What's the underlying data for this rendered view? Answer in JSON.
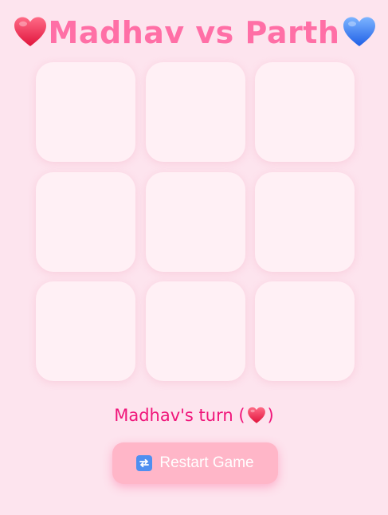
{
  "header": {
    "title": "Madhav vs Parth",
    "left_icon": "red-heart-icon",
    "right_icon": "blue-heart-icon"
  },
  "board": {
    "cells": [
      "",
      "",
      "",
      "",
      "",
      "",
      "",
      "",
      ""
    ]
  },
  "status": {
    "prefix": "Madhav's turn (",
    "suffix": ")",
    "icon": "red-heart-icon"
  },
  "restart": {
    "label": "Restart Game",
    "icon": "refresh-icon"
  },
  "colors": {
    "background": "#fde4ee",
    "title": "#ff6fa6",
    "status": "#f0157a",
    "button": "#ffb6c8",
    "cell": "#fff0f5",
    "player1": "#ff2d55",
    "player2": "#3b7cff"
  }
}
